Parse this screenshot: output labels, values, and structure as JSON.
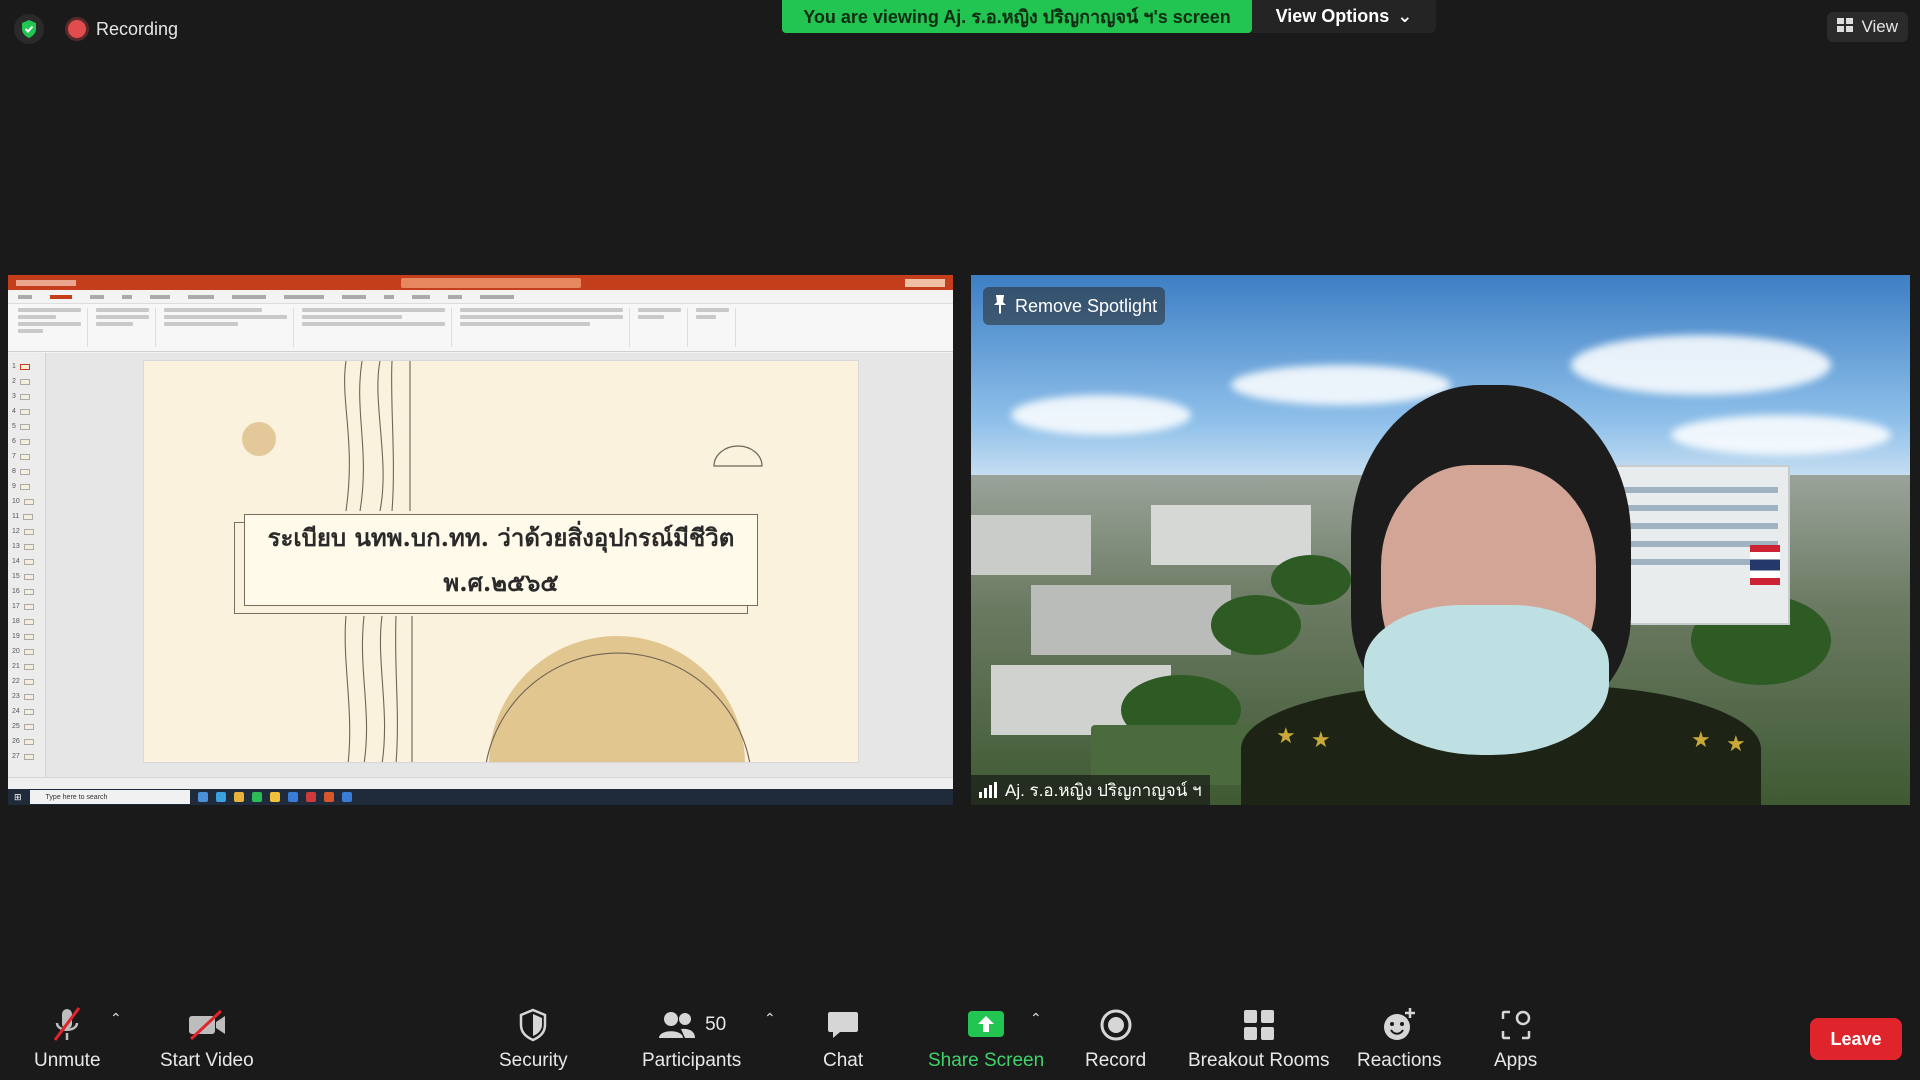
{
  "top": {
    "recording_label": "Recording",
    "viewing_banner": "You are viewing Aj. ร.อ.หญิง ปริญกาญจน์ ฯ's screen",
    "view_options_label": "View Options",
    "view_label": "View"
  },
  "shared_screen": {
    "slide_title_line1": "ระเบียบ นทพ.บก.ทท. ว่าด้วยสิ่งอุปกรณ์มีชีวิต",
    "slide_title_line2": "พ.ศ.๒๕๖๕",
    "taskbar_search_placeholder": "Type here to search",
    "thumb_numbers": [
      "1",
      "2",
      "3",
      "4",
      "5",
      "6",
      "7",
      "8",
      "9",
      "10",
      "11",
      "12",
      "13",
      "14",
      "15",
      "16",
      "17",
      "18",
      "19",
      "20",
      "21",
      "22",
      "23",
      "24",
      "25",
      "26",
      "27"
    ]
  },
  "camera": {
    "remove_spotlight_label": "Remove Spotlight",
    "participant_name": "Aj. ร.อ.หญิง ปริญกาญจน์ ฯ"
  },
  "toolbar": {
    "unmute": "Unmute",
    "start_video": "Start Video",
    "security": "Security",
    "participants": "Participants",
    "participants_count": "50",
    "chat": "Chat",
    "share_screen": "Share Screen",
    "record": "Record",
    "breakout_rooms": "Breakout Rooms",
    "reactions": "Reactions",
    "apps": "Apps",
    "leave": "Leave"
  },
  "colors": {
    "banner_green": "#23c552",
    "share_green": "#3fd36a",
    "leave_red": "#e0242b",
    "ppt_red": "#c43e1c"
  }
}
